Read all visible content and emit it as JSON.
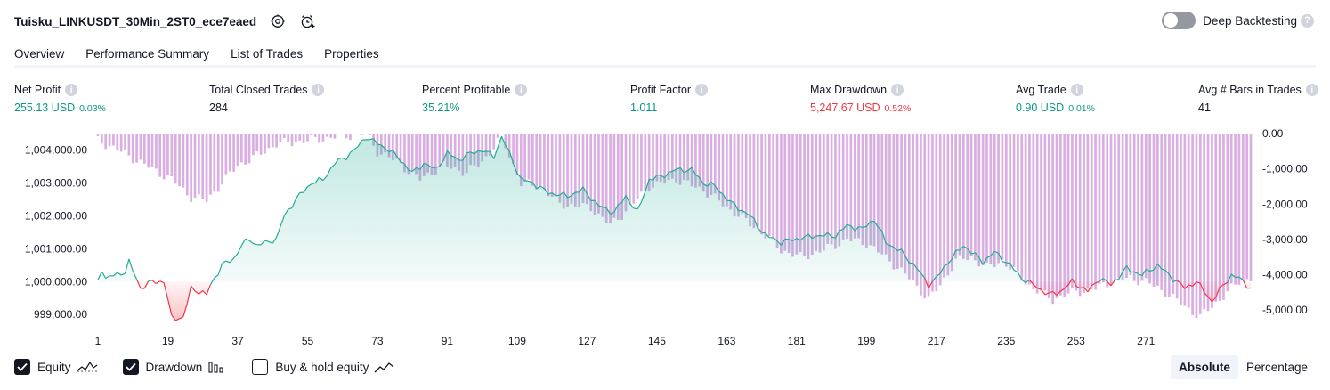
{
  "header": {
    "strategy_title": "Tuisku_LINKUSDT_30Min_2ST0_ece7eaed",
    "icons": [
      "settings-icon",
      "add-alert-icon"
    ],
    "deep_backtesting_label": "Deep Backtesting",
    "deep_backtesting_enabled": false,
    "help_glyph": "?"
  },
  "tabs": [
    {
      "label": "Overview",
      "active": true
    },
    {
      "label": "Performance Summary",
      "active": false
    },
    {
      "label": "List of Trades",
      "active": false
    },
    {
      "label": "Properties",
      "active": false
    }
  ],
  "metrics": [
    {
      "label": "Net Profit",
      "value": "255.13 USD",
      "sub": "0.03%",
      "color": "#089981"
    },
    {
      "label": "Total Closed Trades",
      "value": "284",
      "sub": "",
      "color": "#131722"
    },
    {
      "label": "Percent Profitable",
      "value": "35.21%",
      "sub": "",
      "color": "#089981"
    },
    {
      "label": "Profit Factor",
      "value": "1.011",
      "sub": "",
      "color": "#089981"
    },
    {
      "label": "Max Drawdown",
      "value": "5,247.67 USD",
      "sub": "0.52%",
      "color": "#f23645"
    },
    {
      "label": "Avg Trade",
      "value": "0.90 USD",
      "sub": "0.01%",
      "color": "#089981"
    },
    {
      "label": "Avg # Bars in Trades",
      "value": "41",
      "sub": "",
      "color": "#131722"
    }
  ],
  "info_glyph": "i",
  "chart_data": {
    "type": "line",
    "description_series": [
      "Equity",
      "Drawdown"
    ],
    "x_ticks": [
      "1",
      "19",
      "37",
      "55",
      "73",
      "91",
      "109",
      "127",
      "145",
      "163",
      "181",
      "199",
      "217",
      "235",
      "253",
      "271"
    ],
    "left_axis": {
      "ticks": [
        "1,004,000.00",
        "1,003,000.00",
        "1,002,000.00",
        "1,001,000.00",
        "1,000,000.00",
        "999,000.00"
      ],
      "range": [
        998600,
        1004500
      ]
    },
    "right_axis": {
      "ticks": [
        "0.00",
        "-1,000.00",
        "-2,000.00",
        "-3,000.00",
        "-4,000.00",
        "-5,000.00"
      ],
      "range": [
        -5500,
        0
      ]
    },
    "baseline": 1000000,
    "equity_anchor_points": [
      [
        1,
        1000000
      ],
      [
        2,
        1000400
      ],
      [
        3,
        1000100
      ],
      [
        8,
        1000300
      ],
      [
        9,
        1000600
      ],
      [
        12,
        999800
      ],
      [
        15,
        1000000
      ],
      [
        18,
        1000000
      ],
      [
        20,
        998900
      ],
      [
        23,
        998900
      ],
      [
        25,
        999800
      ],
      [
        27,
        999700
      ],
      [
        29,
        999600
      ],
      [
        30,
        999900
      ],
      [
        33,
        1000500
      ],
      [
        36,
        1000700
      ],
      [
        38,
        1001100
      ],
      [
        40,
        1001300
      ],
      [
        42,
        1001100
      ],
      [
        47,
        1001300
      ],
      [
        49,
        1002000
      ],
      [
        52,
        1002500
      ],
      [
        56,
        1003000
      ],
      [
        59,
        1003100
      ],
      [
        62,
        1003600
      ],
      [
        65,
        1003800
      ],
      [
        68,
        1004100
      ],
      [
        70,
        1004400
      ],
      [
        73,
        1004200
      ],
      [
        76,
        1004000
      ],
      [
        79,
        1003700
      ],
      [
        82,
        1003300
      ],
      [
        85,
        1003600
      ],
      [
        88,
        1003400
      ],
      [
        91,
        1003900
      ],
      [
        94,
        1003700
      ],
      [
        97,
        1003900
      ],
      [
        100,
        1004000
      ],
      [
        103,
        1003800
      ],
      [
        105,
        1004400
      ],
      [
        107,
        1003900
      ],
      [
        110,
        1003100
      ],
      [
        113,
        1003000
      ],
      [
        117,
        1002700
      ],
      [
        122,
        1002600
      ],
      [
        126,
        1002800
      ],
      [
        130,
        1002300
      ],
      [
        134,
        1002100
      ],
      [
        137,
        1002600
      ],
      [
        140,
        1002100
      ],
      [
        143,
        1003100
      ],
      [
        146,
        1003200
      ],
      [
        150,
        1003400
      ],
      [
        154,
        1003400
      ],
      [
        157,
        1003000
      ],
      [
        160,
        1002900
      ],
      [
        164,
        1002400
      ],
      [
        169,
        1002000
      ],
      [
        173,
        1001400
      ],
      [
        177,
        1001200
      ],
      [
        181,
        1001300
      ],
      [
        186,
        1001400
      ],
      [
        191,
        1001400
      ],
      [
        194,
        1001700
      ],
      [
        198,
        1001600
      ],
      [
        201,
        1001900
      ],
      [
        204,
        1001200
      ],
      [
        208,
        1000900
      ],
      [
        212,
        1000400
      ],
      [
        215,
        999900
      ],
      [
        217,
        1000100
      ],
      [
        220,
        1000600
      ],
      [
        224,
        1001100
      ],
      [
        229,
        1000600
      ],
      [
        232,
        1000900
      ],
      [
        236,
        1000500
      ],
      [
        239,
        1000100
      ],
      [
        242,
        999900
      ],
      [
        246,
        999600
      ],
      [
        249,
        999700
      ],
      [
        252,
        1000000
      ],
      [
        256,
        999700
      ],
      [
        259,
        1000100
      ],
      [
        262,
        999900
      ],
      [
        266,
        1000400
      ],
      [
        270,
        1000200
      ],
      [
        274,
        1000500
      ],
      [
        278,
        1000100
      ],
      [
        281,
        999800
      ],
      [
        284,
        1000000
      ],
      [
        288,
        999400
      ],
      [
        291,
        999900
      ],
      [
        293,
        1000200
      ],
      [
        295,
        1000100
      ],
      [
        298,
        999800
      ]
    ],
    "drawdown_anchor_points": [
      [
        1,
        -200
      ],
      [
        5,
        -400
      ],
      [
        10,
        -700
      ],
      [
        15,
        -1000
      ],
      [
        20,
        -1300
      ],
      [
        25,
        -1800
      ],
      [
        29,
        -1900
      ],
      [
        33,
        -1400
      ],
      [
        37,
        -900
      ],
      [
        41,
        -700
      ],
      [
        47,
        -300
      ],
      [
        55,
        -200
      ],
      [
        62,
        -100
      ],
      [
        70,
        0
      ],
      [
        73,
        -500
      ],
      [
        78,
        -800
      ],
      [
        84,
        -1300
      ],
      [
        90,
        -900
      ],
      [
        96,
        -1100
      ],
      [
        100,
        -800
      ],
      [
        105,
        -100
      ],
      [
        110,
        -1400
      ],
      [
        115,
        -1500
      ],
      [
        120,
        -2000
      ],
      [
        128,
        -2100
      ],
      [
        133,
        -2600
      ],
      [
        138,
        -2100
      ],
      [
        143,
        -1500
      ],
      [
        150,
        -1300
      ],
      [
        157,
        -1600
      ],
      [
        162,
        -2000
      ],
      [
        167,
        -2400
      ],
      [
        172,
        -2800
      ],
      [
        177,
        -3300
      ],
      [
        182,
        -3500
      ],
      [
        188,
        -3300
      ],
      [
        194,
        -3000
      ],
      [
        199,
        -3100
      ],
      [
        205,
        -3600
      ],
      [
        210,
        -4100
      ],
      [
        215,
        -4700
      ],
      [
        218,
        -4300
      ],
      [
        222,
        -3600
      ],
      [
        226,
        -3500
      ],
      [
        230,
        -3800
      ],
      [
        234,
        -3600
      ],
      [
        238,
        -4000
      ],
      [
        242,
        -4400
      ],
      [
        247,
        -4700
      ],
      [
        252,
        -4500
      ],
      [
        258,
        -4400
      ],
      [
        262,
        -4200
      ],
      [
        267,
        -4100
      ],
      [
        271,
        -4200
      ],
      [
        276,
        -4500
      ],
      [
        281,
        -4900
      ],
      [
        285,
        -5200
      ],
      [
        289,
        -4800
      ],
      [
        295,
        -4200
      ],
      [
        298,
        -4100
      ]
    ],
    "x_range": [
      1,
      298
    ],
    "colors": {
      "equity_line": "#22ab94",
      "equity_fill": "#22ab94",
      "equity_below": "#f23645",
      "drawdown_bar": "#ce93d8"
    }
  },
  "legend": [
    {
      "label": "Equity",
      "checked": true,
      "icon": "equity-line-icon"
    },
    {
      "label": "Drawdown",
      "checked": true,
      "icon": "drawdown-bars-icon"
    },
    {
      "label": "Buy & hold equity",
      "checked": false,
      "icon": "buy-hold-line-icon"
    }
  ],
  "view_mode": {
    "options": [
      "Absolute",
      "Percentage"
    ],
    "selected": "Absolute"
  }
}
